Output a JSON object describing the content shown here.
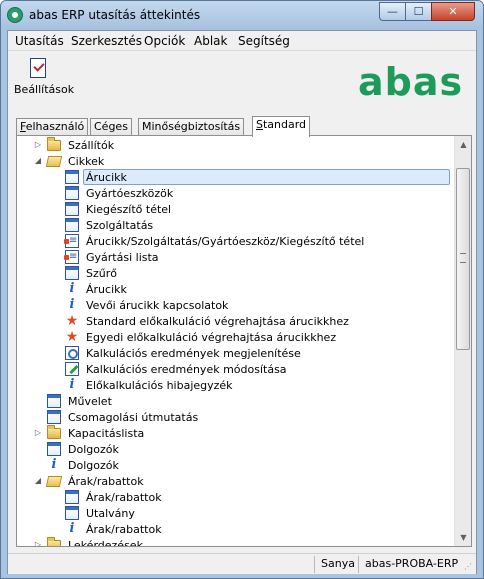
{
  "window": {
    "title": "abas ERP utasítás áttekintés",
    "controls": {
      "minimize": "—",
      "maximize": "☐",
      "close": "✕"
    }
  },
  "menu": [
    "Utasítás",
    "Szerkesztés",
    "Opciók",
    "Ablak",
    "Segítség"
  ],
  "toolbar": {
    "settings_label": "Beállítások",
    "logo_text": "abas"
  },
  "tabs": [
    {
      "label": "Felhasználó",
      "underline": "F",
      "rest": "elhasználó"
    },
    {
      "label": "Céges",
      "underline": "",
      "rest": "Céges"
    },
    {
      "label": "Minőségbiztosítás",
      "underline": "",
      "rest": "Minőségbiztosítás"
    },
    {
      "label": "Standard",
      "underline": "S",
      "rest": "tandard"
    }
  ],
  "active_tab": "Standard",
  "tree": [
    {
      "label": "Szállítók",
      "icon": "folder",
      "twist": "collapsed"
    },
    {
      "label": "Cikkek",
      "icon": "folder-open",
      "twist": "expanded"
    },
    {
      "label": "Árucikk",
      "icon": "doc",
      "twist": "",
      "selected": true
    },
    {
      "label": "Gyártóeszközök",
      "icon": "doc",
      "twist": ""
    },
    {
      "label": "Kiegészítő tétel",
      "icon": "doc",
      "twist": ""
    },
    {
      "label": "Szolgáltatás",
      "icon": "doc",
      "twist": ""
    },
    {
      "label": "Árucikk/Szolgáltatás/Gyártóeszköz/Kiegészítő tétel",
      "icon": "listdoc",
      "twist": ""
    },
    {
      "label": "Gyártási lista",
      "icon": "listdoc",
      "twist": ""
    },
    {
      "label": "Szűrő",
      "icon": "doc",
      "twist": ""
    },
    {
      "label": "Árucikk",
      "icon": "info",
      "twist": ""
    },
    {
      "label": "Vevői árucikk kapcsolatok",
      "icon": "info",
      "twist": ""
    },
    {
      "label": "Standard előkalkuláció végrehajtása árucikkhez",
      "icon": "star",
      "twist": ""
    },
    {
      "label": "Egyedi előkalkuláció végrehajtása árucikkhez",
      "icon": "star",
      "twist": ""
    },
    {
      "label": "Kalkulációs eredmények megjelenítése",
      "icon": "view",
      "twist": ""
    },
    {
      "label": "Kalkulációs eredmények módosítása",
      "icon": "edit",
      "twist": ""
    },
    {
      "label": "Előkalkulációs hibajegyzék",
      "icon": "info",
      "twist": ""
    },
    {
      "label": "Művelet",
      "icon": "doc",
      "twist": ""
    },
    {
      "label": "Csomagolási útmutatás",
      "icon": "doc",
      "twist": ""
    },
    {
      "label": "Kapacitáslista",
      "icon": "folder",
      "twist": "collapsed"
    },
    {
      "label": "Dolgozók",
      "icon": "doc",
      "twist": ""
    },
    {
      "label": "Dolgozók",
      "icon": "info",
      "twist": ""
    },
    {
      "label": "Árak/rabattok",
      "icon": "folder-open",
      "twist": "expanded"
    },
    {
      "label": "Árak/rabattok",
      "icon": "doc",
      "twist": ""
    },
    {
      "label": "Utalvány",
      "icon": "doc",
      "twist": ""
    },
    {
      "label": "Árak/rabattok",
      "icon": "info",
      "twist": ""
    },
    {
      "label": "Lekérdezések",
      "icon": "folder",
      "twist": "collapsed"
    }
  ],
  "status": {
    "user": "Sanya",
    "client": "abas-PROBA-ERP"
  }
}
